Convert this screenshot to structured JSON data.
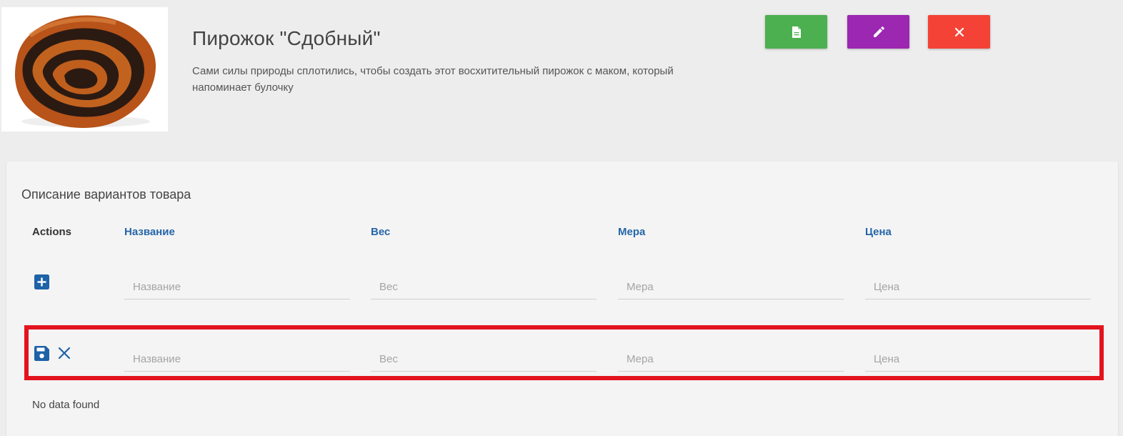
{
  "product": {
    "title": "Пирожок \"Сдобный\"",
    "description": "Сами силы природы сплотились, чтобы создать этот восхитительный пирожок с маком, который напоминает булочку"
  },
  "header_buttons": [
    {
      "icon": "document-icon",
      "color": "#4caf50"
    },
    {
      "icon": "pencil-icon",
      "color": "#9c27b0"
    },
    {
      "icon": "close-icon",
      "color": "#f44336"
    }
  ],
  "variants": {
    "title": "Описание вариантов товара",
    "columns": {
      "actions": "Actions",
      "name": "Название",
      "weight": "Вес",
      "measure": "Мера",
      "price": "Цена"
    },
    "new_row": {
      "icon": "plus-square-icon",
      "name_placeholder": "Название",
      "weight_placeholder": "Вес",
      "measure_placeholder": "Мера",
      "price_placeholder": "Цена"
    },
    "edit_row": {
      "icons": [
        "save-icon",
        "cancel-icon"
      ],
      "name_placeholder": "Название",
      "weight_placeholder": "Вес",
      "measure_placeholder": "Мера",
      "price_placeholder": "Цена"
    },
    "empty_text": "No data found"
  },
  "colors": {
    "link": "#2566a8",
    "highlight": "#e3141e",
    "icon_blue": "#1e62a8"
  }
}
